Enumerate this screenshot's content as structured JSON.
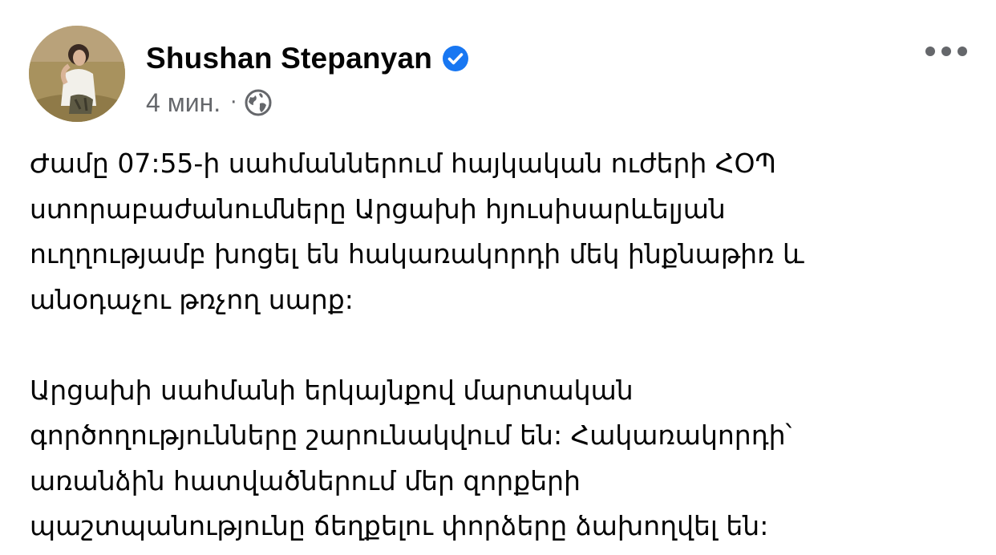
{
  "post": {
    "author_name": "Shushan Stepanyan",
    "timestamp": "4 мин.",
    "separator": "·",
    "icons": {
      "verified": "verified-badge-icon",
      "privacy": "globe-icon",
      "more": "more-options-icon"
    },
    "colors": {
      "verified_badge": "#1877f2",
      "meta_text": "#65676b",
      "body_text": "#050505"
    },
    "paragraphs": [
      {
        "lines": [
          "Ժամը 07:55-ի սահմաններում հայկական ուժերի ՀՕՊ",
          "ստորաբաժանումները Արցախի հյուսիսարևելյան",
          "ուղղությամբ խոցել են հակառակորդի մեկ ինքնաթիռ և",
          "անօդաչու թռչող սարք:"
        ]
      },
      {
        "lines": [
          "Արցախի սահմանի երկայնքով մարտական",
          "գործողությունները շարունակվում են: Հակառակորդի՝",
          "առանձին հատվածներում մեր զորքերի",
          "պաշտպանությունը ճեղքելու փորձերը ձախողվել են:"
        ]
      }
    ]
  }
}
